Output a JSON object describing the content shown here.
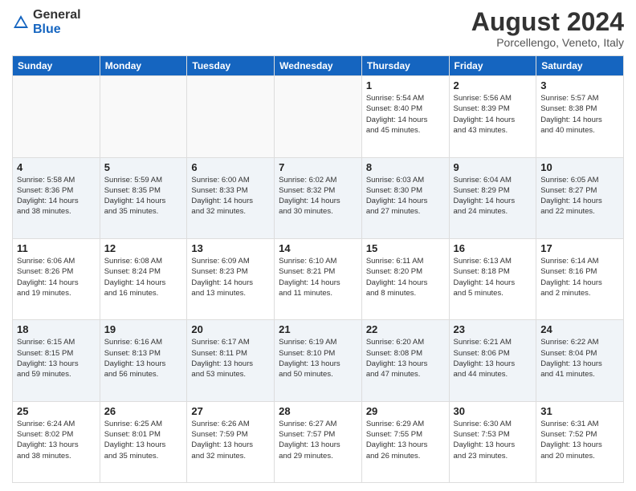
{
  "header": {
    "logo_general": "General",
    "logo_blue": "Blue",
    "title": "August 2024",
    "subtitle": "Porcellengo, Veneto, Italy"
  },
  "days_of_week": [
    "Sunday",
    "Monday",
    "Tuesday",
    "Wednesday",
    "Thursday",
    "Friday",
    "Saturday"
  ],
  "weeks": [
    [
      {
        "day": "",
        "info": ""
      },
      {
        "day": "",
        "info": ""
      },
      {
        "day": "",
        "info": ""
      },
      {
        "day": "",
        "info": ""
      },
      {
        "day": "1",
        "info": "Sunrise: 5:54 AM\nSunset: 8:40 PM\nDaylight: 14 hours\nand 45 minutes."
      },
      {
        "day": "2",
        "info": "Sunrise: 5:56 AM\nSunset: 8:39 PM\nDaylight: 14 hours\nand 43 minutes."
      },
      {
        "day": "3",
        "info": "Sunrise: 5:57 AM\nSunset: 8:38 PM\nDaylight: 14 hours\nand 40 minutes."
      }
    ],
    [
      {
        "day": "4",
        "info": "Sunrise: 5:58 AM\nSunset: 8:36 PM\nDaylight: 14 hours\nand 38 minutes."
      },
      {
        "day": "5",
        "info": "Sunrise: 5:59 AM\nSunset: 8:35 PM\nDaylight: 14 hours\nand 35 minutes."
      },
      {
        "day": "6",
        "info": "Sunrise: 6:00 AM\nSunset: 8:33 PM\nDaylight: 14 hours\nand 32 minutes."
      },
      {
        "day": "7",
        "info": "Sunrise: 6:02 AM\nSunset: 8:32 PM\nDaylight: 14 hours\nand 30 minutes."
      },
      {
        "day": "8",
        "info": "Sunrise: 6:03 AM\nSunset: 8:30 PM\nDaylight: 14 hours\nand 27 minutes."
      },
      {
        "day": "9",
        "info": "Sunrise: 6:04 AM\nSunset: 8:29 PM\nDaylight: 14 hours\nand 24 minutes."
      },
      {
        "day": "10",
        "info": "Sunrise: 6:05 AM\nSunset: 8:27 PM\nDaylight: 14 hours\nand 22 minutes."
      }
    ],
    [
      {
        "day": "11",
        "info": "Sunrise: 6:06 AM\nSunset: 8:26 PM\nDaylight: 14 hours\nand 19 minutes."
      },
      {
        "day": "12",
        "info": "Sunrise: 6:08 AM\nSunset: 8:24 PM\nDaylight: 14 hours\nand 16 minutes."
      },
      {
        "day": "13",
        "info": "Sunrise: 6:09 AM\nSunset: 8:23 PM\nDaylight: 14 hours\nand 13 minutes."
      },
      {
        "day": "14",
        "info": "Sunrise: 6:10 AM\nSunset: 8:21 PM\nDaylight: 14 hours\nand 11 minutes."
      },
      {
        "day": "15",
        "info": "Sunrise: 6:11 AM\nSunset: 8:20 PM\nDaylight: 14 hours\nand 8 minutes."
      },
      {
        "day": "16",
        "info": "Sunrise: 6:13 AM\nSunset: 8:18 PM\nDaylight: 14 hours\nand 5 minutes."
      },
      {
        "day": "17",
        "info": "Sunrise: 6:14 AM\nSunset: 8:16 PM\nDaylight: 14 hours\nand 2 minutes."
      }
    ],
    [
      {
        "day": "18",
        "info": "Sunrise: 6:15 AM\nSunset: 8:15 PM\nDaylight: 13 hours\nand 59 minutes."
      },
      {
        "day": "19",
        "info": "Sunrise: 6:16 AM\nSunset: 8:13 PM\nDaylight: 13 hours\nand 56 minutes."
      },
      {
        "day": "20",
        "info": "Sunrise: 6:17 AM\nSunset: 8:11 PM\nDaylight: 13 hours\nand 53 minutes."
      },
      {
        "day": "21",
        "info": "Sunrise: 6:19 AM\nSunset: 8:10 PM\nDaylight: 13 hours\nand 50 minutes."
      },
      {
        "day": "22",
        "info": "Sunrise: 6:20 AM\nSunset: 8:08 PM\nDaylight: 13 hours\nand 47 minutes."
      },
      {
        "day": "23",
        "info": "Sunrise: 6:21 AM\nSunset: 8:06 PM\nDaylight: 13 hours\nand 44 minutes."
      },
      {
        "day": "24",
        "info": "Sunrise: 6:22 AM\nSunset: 8:04 PM\nDaylight: 13 hours\nand 41 minutes."
      }
    ],
    [
      {
        "day": "25",
        "info": "Sunrise: 6:24 AM\nSunset: 8:02 PM\nDaylight: 13 hours\nand 38 minutes."
      },
      {
        "day": "26",
        "info": "Sunrise: 6:25 AM\nSunset: 8:01 PM\nDaylight: 13 hours\nand 35 minutes."
      },
      {
        "day": "27",
        "info": "Sunrise: 6:26 AM\nSunset: 7:59 PM\nDaylight: 13 hours\nand 32 minutes."
      },
      {
        "day": "28",
        "info": "Sunrise: 6:27 AM\nSunset: 7:57 PM\nDaylight: 13 hours\nand 29 minutes."
      },
      {
        "day": "29",
        "info": "Sunrise: 6:29 AM\nSunset: 7:55 PM\nDaylight: 13 hours\nand 26 minutes."
      },
      {
        "day": "30",
        "info": "Sunrise: 6:30 AM\nSunset: 7:53 PM\nDaylight: 13 hours\nand 23 minutes."
      },
      {
        "day": "31",
        "info": "Sunrise: 6:31 AM\nSunset: 7:52 PM\nDaylight: 13 hours\nand 20 minutes."
      }
    ]
  ]
}
